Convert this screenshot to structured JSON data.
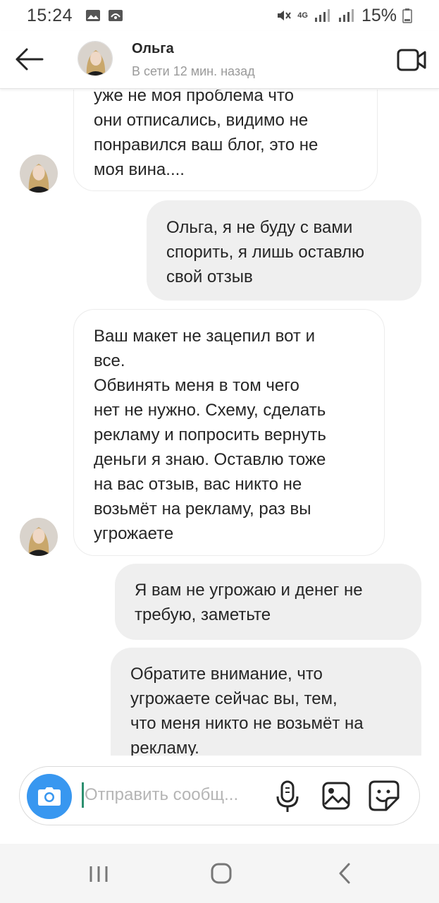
{
  "status_bar": {
    "time": "15:24",
    "network": "4G",
    "battery": "15%"
  },
  "header": {
    "contact_name": "Ольга",
    "contact_status": "В сети 12 мин. назад"
  },
  "messages": [
    {
      "direction": "incoming",
      "lines": [
        "уже не моя проблема что",
        "они отписались, видимо не",
        "понравился ваш блог, это не",
        "моя вина...."
      ]
    },
    {
      "direction": "outgoing",
      "lines": [
        "Ольга, я не буду с вами",
        "спорить, я лишь оставлю",
        "свой отзыв"
      ]
    },
    {
      "direction": "incoming",
      "lines": [
        "Ваш макет не зацепил вот и",
        "все.",
        "Обвинять меня в том чего",
        "нет не нужно. Схему, сделать",
        "рекламу и попросить вернуть",
        "деньги я знаю. Оставлю тоже",
        "на вас отзыв, вас никто не",
        "возьмёт на рекламу, раз вы",
        "угрожаете"
      ]
    },
    {
      "direction": "outgoing",
      "lines": [
        "Я вам не угрожаю и денег не",
        "требую, заметьте"
      ]
    },
    {
      "direction": "outgoing",
      "lines": [
        "Обратите внимание, что",
        "угрожаете сейчас вы, тем,",
        "что меня никто не возьмёт на",
        "рекламу."
      ]
    }
  ],
  "composer": {
    "placeholder": "Отправить сообщ...",
    "value": ""
  },
  "colors": {
    "accent_blue": "#3897f0",
    "outgoing_bubble": "#efefef",
    "caret": "#2c8f6f"
  },
  "icons": {
    "back": "arrow-left-icon",
    "video": "video-camera-icon",
    "camera": "camera-icon",
    "mic": "microphone-icon",
    "gallery": "gallery-icon",
    "sticker": "sticker-icon"
  }
}
